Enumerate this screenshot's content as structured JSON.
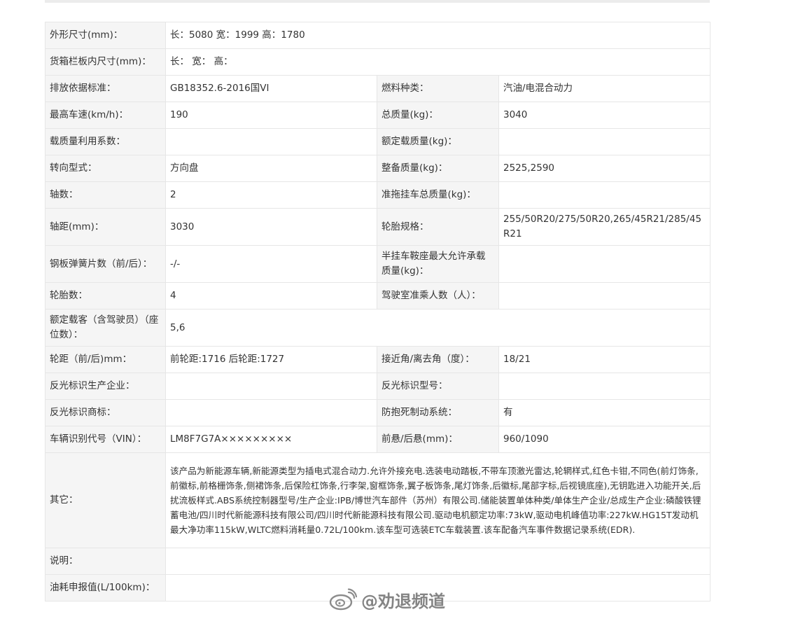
{
  "rows": [
    {
      "l1": "外形尺寸(mm)：",
      "v1": "长：5080 宽：1999 高：1780"
    },
    {
      "l1": "货箱栏板内尺寸(mm)：",
      "v1": "长： 宽： 高："
    },
    {
      "l1": "排放依据标准：",
      "v1": "GB18352.6-2016国VI",
      "l2": "燃料种类：",
      "v2": "汽油/电混合动力"
    },
    {
      "l1": "最高车速(km/h)：",
      "v1": "190",
      "l2": "总质量(kg)：",
      "v2": "3040"
    },
    {
      "l1": "载质量利用系数：",
      "v1": "",
      "l2": "额定载质量(kg)：",
      "v2": ""
    },
    {
      "l1": "转向型式：",
      "v1": "方向盘",
      "l2": "整备质量(kg)：",
      "v2": "2525,2590"
    },
    {
      "l1": "轴数：",
      "v1": "2",
      "l2": "准拖挂车总质量(kg)：",
      "v2": ""
    },
    {
      "l1": "轴距(mm)：",
      "v1": "3030",
      "l2": "轮胎规格：",
      "v2": "255/50R20/275/50R20,265/45R21/285/45R21"
    },
    {
      "l1": "钢板弹簧片数（前/后）：",
      "v1": "-/-",
      "l2": "半挂车鞍座最大允许承载质量(kg)：",
      "v2": ""
    },
    {
      "l1": "轮胎数：",
      "v1": "4",
      "l2": "驾驶室准乘人数（人）：",
      "v2": ""
    },
    {
      "l1": "额定载客（含驾驶员）（座位数）：",
      "v1": "5,6"
    },
    {
      "l1": "轮距（前/后)mm：",
      "v1": "前轮距:1716 后轮距:1727",
      "l2": "接近角/离去角（度）：",
      "v2": "18/21"
    },
    {
      "l1": "反光标识生产企业：",
      "v1": "",
      "l2": "反光标识型号：",
      "v2": ""
    },
    {
      "l1": "反光标识商标：",
      "v1": "",
      "l2": "防抱死制动系统：",
      "v2": "有"
    },
    {
      "l1": "车辆识别代号（VIN）：",
      "v1": "LM8F7G7A×××××××××",
      "l2": "前悬/后悬(mm)：",
      "v2": "960/1090"
    },
    {
      "l1": "其它：",
      "v1": "该产品为新能源车辆,新能源类型为插电式混合动力.允许外接充电.选装电动踏板,不带车顶激光雷达,轮辋样式,红色卡钳,不同色(前灯饰条,前徽标,前格栅饰条,侧裙饰条,后保险杠饰条,行李架,窗框饰条,翼子板饰条,尾灯饰条,后徽标,尾部字标,后视镜底座),无钥匙进入功能开关,后扰流板样式.ABS系统控制器型号/生产企业:IPB/博世汽车部件（苏州）有限公司.储能装置单体种类/单体生产企业/总成生产企业:磷酸铁锂蓄电池/四川时代新能源科技有限公司/四川时代新能源科技有限公司.驱动电机额定功率:73kW,驱动电机峰值功率:227kW.HG15T发动机最大净功率115kW,WLTC燃料消耗量0.72L/100km.该车型可选装ETC车载装置.该车配备汽车事件数据记录系统(EDR)."
    },
    {
      "l1": "说明：",
      "v1": ""
    },
    {
      "l1": "油耗申报值(L/100km)：",
      "v1": ""
    }
  ],
  "watermark": {
    "text": "@劝退频道",
    "icon": "weibo-logo-icon"
  }
}
